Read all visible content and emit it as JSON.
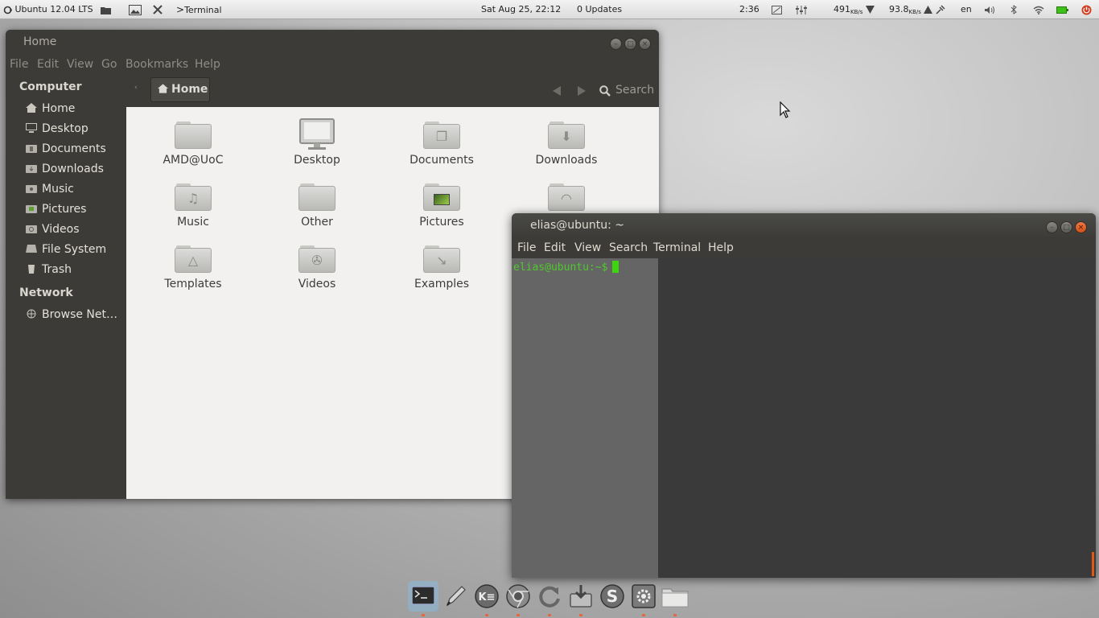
{
  "top_panel": {
    "distro_label": "Ubuntu 12.04 LTS",
    "active_app": "Terminal",
    "datetime": "Sat Aug 25, 22:12",
    "updates": "0 Updates",
    "clock": "2:36",
    "net_down_value": "491",
    "net_down_unit": "KB/s",
    "net_up_value": "93.8",
    "net_up_unit": "KB/s",
    "keyboard_layout": "en"
  },
  "nautilus": {
    "title": "Home",
    "menu": [
      "File",
      "Edit",
      "View",
      "Go",
      "Bookmarks",
      "Help"
    ],
    "sidebar": {
      "computer_heading": "Computer",
      "computer_items": [
        "Home",
        "Desktop",
        "Documents",
        "Downloads",
        "Music",
        "Pictures",
        "Videos",
        "File System",
        "Trash"
      ],
      "network_heading": "Network",
      "network_items": [
        "Browse Net…"
      ]
    },
    "path_button": "Home",
    "search_label": "Search",
    "files": [
      "AMD@UoC",
      "Desktop",
      "Documents",
      "Downloads",
      "Music",
      "Other",
      "Pictures",
      "Templates",
      "Videos",
      "Examples"
    ]
  },
  "terminal": {
    "title": "elias@ubuntu: ~",
    "menu": [
      "File",
      "Edit",
      "View",
      "Search",
      "Terminal",
      "Help"
    ],
    "prompt": "elias@ubuntu:~$"
  },
  "dock": {
    "icons": [
      "terminal-icon",
      "pen-icon",
      "kde-icon",
      "chrome-icon",
      "refresh-icon",
      "install-icon",
      "skype-icon",
      "settings-icon",
      "folder-icon"
    ]
  },
  "colors": {
    "terminal_prompt": "#4eca2a",
    "terminal_cursor": "#3dd50c",
    "ubuntu_dark": "#3c3b37",
    "close_button": "#e05a14"
  }
}
